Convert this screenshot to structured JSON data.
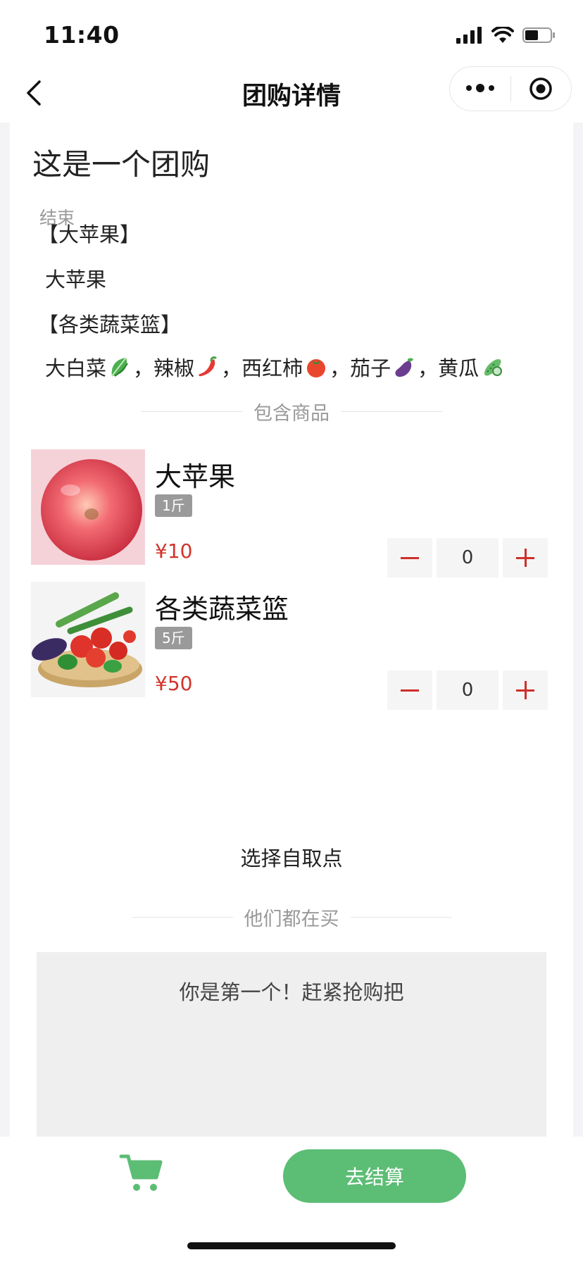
{
  "status_bar": {
    "time": "11:40"
  },
  "nav": {
    "title": "团购详情"
  },
  "group": {
    "title": "这是一个团购",
    "status": "结束"
  },
  "sections": [
    {
      "title": "【大苹果】",
      "desc": "大苹果"
    },
    {
      "title": "【各类蔬菜篮】"
    }
  ],
  "vegetables": [
    {
      "name": "大白菜",
      "emoji": "leafy-green",
      "sep": "，"
    },
    {
      "name": "辣椒",
      "emoji": "hot-pepper",
      "sep": "，"
    },
    {
      "name": "西红柿",
      "emoji": "tomato",
      "sep": "，"
    },
    {
      "name": "茄子",
      "emoji": "eggplant",
      "sep": "，"
    },
    {
      "name": "黄瓜",
      "emoji": "cucumber",
      "sep": ""
    }
  ],
  "products_header": "包含商品",
  "products": [
    {
      "name": "大苹果",
      "spec": "1斤",
      "price": "¥10",
      "quantity": "0",
      "image": "apple"
    },
    {
      "name": "各类蔬菜篮",
      "spec": "5斤",
      "price": "¥50",
      "quantity": "0",
      "image": "vegetable-basket"
    }
  ],
  "pickup_label": "选择自取点",
  "buyers_header": "他们都在买",
  "buyers_empty": "你是第一个！赶紧抢购把",
  "bottom": {
    "checkout_label": "去结算",
    "cart_icon": "cart-icon"
  },
  "colors": {
    "accent_green": "#5cbd75",
    "price_red": "#d0342c",
    "stepper_red": "#cf2f2a"
  }
}
